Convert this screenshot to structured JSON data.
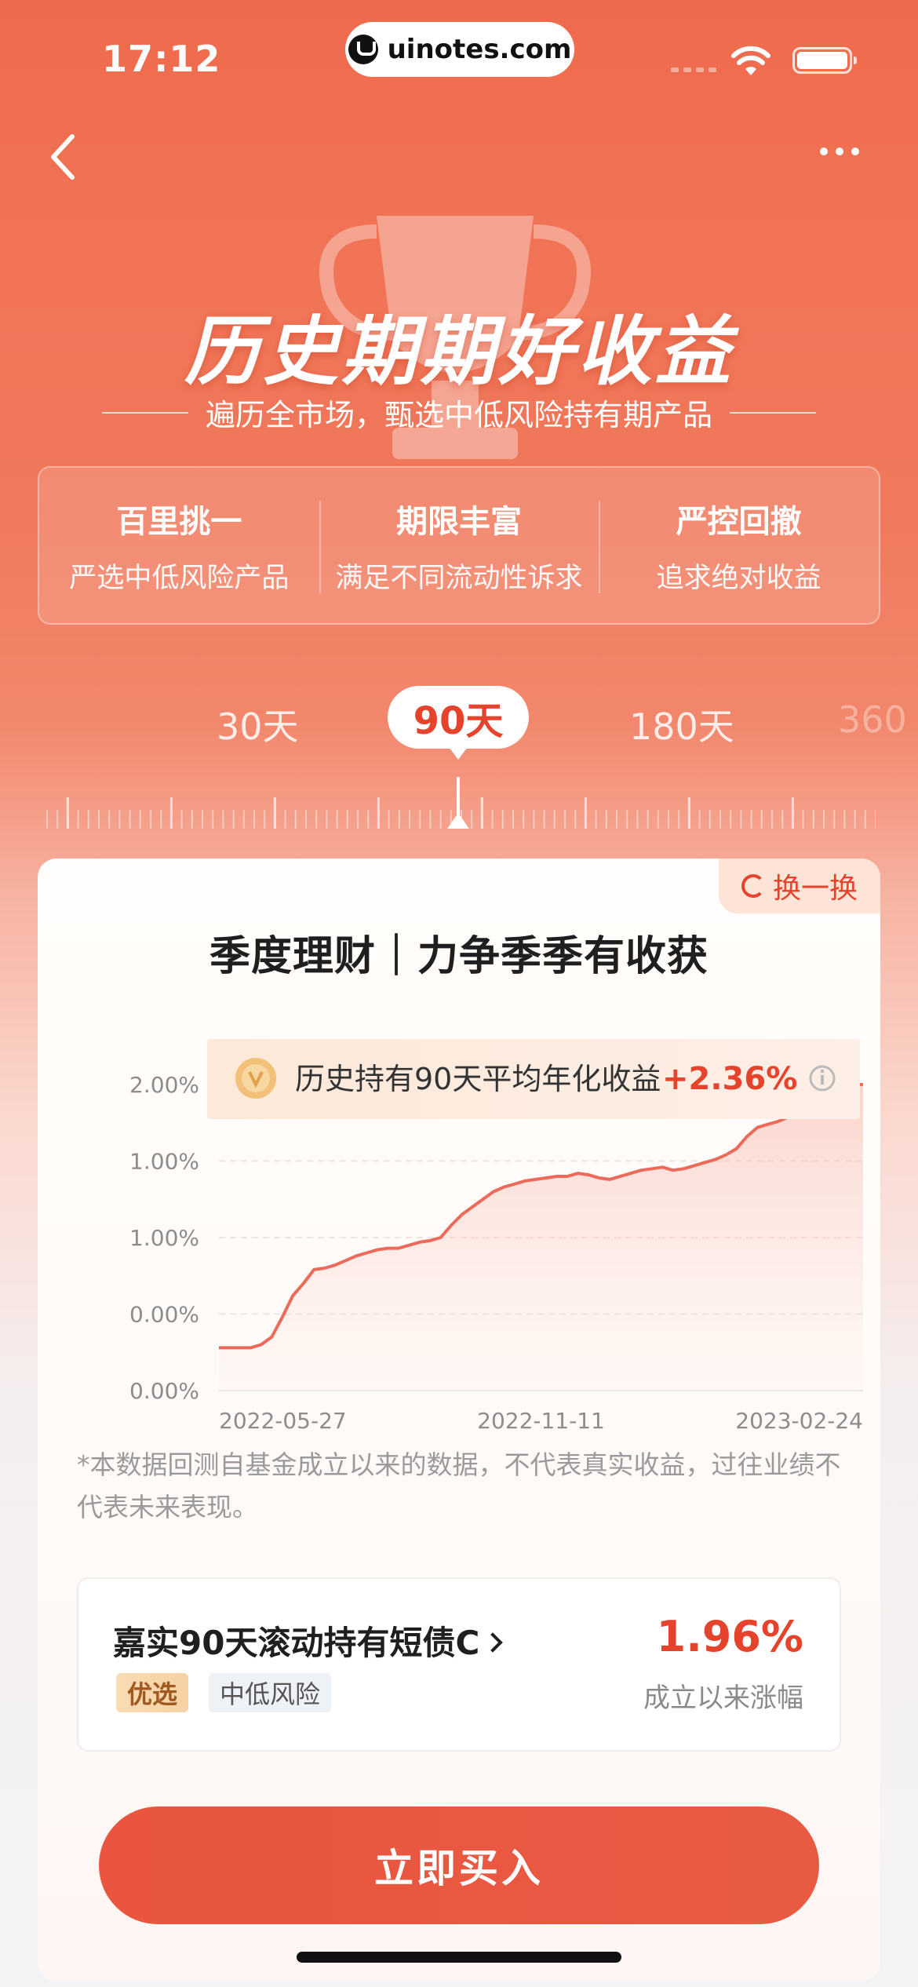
{
  "status_bar": {
    "time": "17:12",
    "url": "uinotes.com"
  },
  "hero": {
    "title": "历史期期好收益",
    "subtitle": "遍历全市场，甄选中低风险持有期产品",
    "features": [
      {
        "title": "百里挑一",
        "desc": "严选中低风险产品"
      },
      {
        "title": "期限丰富",
        "desc": "满足不同流动性诉求"
      },
      {
        "title": "严控回撤",
        "desc": "追求绝对收益"
      }
    ]
  },
  "periods": {
    "items": [
      "30天",
      "90天",
      "180天",
      "360"
    ],
    "selected": "90天"
  },
  "card": {
    "switch_label": "换一换",
    "title": "季度理财｜力争季季有收获",
    "banner_text": "历史持有90天平均年化收益",
    "banner_value": "+2.36%",
    "disclaimer": "*本数据回测自基金成立以来的数据，不代表真实收益，过往业绩不代表未来表现。",
    "fund": {
      "name": "嘉实90天滚动持有短债C",
      "tags": [
        "优选",
        "中低风险"
      ],
      "rate": "1.96%",
      "rate_label": "成立以来涨幅"
    },
    "buy_label": "立即买入"
  },
  "colors": {
    "accent": "#e5432c",
    "line": "#ec6a5a"
  },
  "chart_data": {
    "type": "area",
    "ytick_labels": [
      "2.00%",
      "1.00%",
      "1.00%",
      "0.00%",
      "0.00%"
    ],
    "xtick_labels": [
      "2022-05-27",
      "2022-11-11",
      "2023-02-24"
    ],
    "ylim": [
      0,
      2.0
    ],
    "series": [
      {
        "values": [
          0.28,
          0.28,
          0.28,
          0.28,
          0.3,
          0.35,
          0.48,
          0.62,
          0.7,
          0.79,
          0.8,
          0.82,
          0.85,
          0.88,
          0.9,
          0.92,
          0.93,
          0.93,
          0.95,
          0.97,
          0.98,
          1.0,
          1.08,
          1.15,
          1.2,
          1.25,
          1.3,
          1.33,
          1.35,
          1.37,
          1.38,
          1.39,
          1.4,
          1.4,
          1.42,
          1.41,
          1.39,
          1.38,
          1.4,
          1.42,
          1.44,
          1.45,
          1.46,
          1.44,
          1.45,
          1.47,
          1.49,
          1.51,
          1.54,
          1.58,
          1.66,
          1.72,
          1.74,
          1.76,
          1.79,
          1.84,
          1.9,
          1.94,
          1.96,
          1.98,
          2.0,
          2.0
        ]
      }
    ]
  }
}
